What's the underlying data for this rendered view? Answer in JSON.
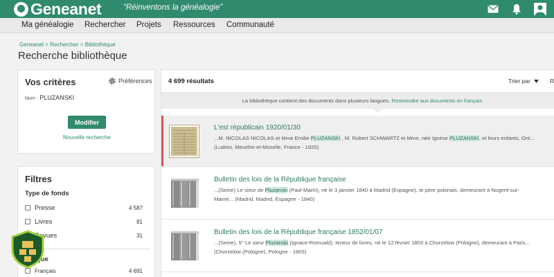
{
  "header": {
    "brand": "Geneanet",
    "slogan": "“Réinventons la généalogie”",
    "icons": [
      "mail-icon",
      "bell-icon",
      "user-icon"
    ]
  },
  "nav": [
    "Ma généalogie",
    "Rechercher",
    "Projets",
    "Ressources",
    "Communauté"
  ],
  "breadcrumb": "Geneanet > Rechercher > Bibliothèque",
  "page_title": "Recherche bibliothèque",
  "criteria": {
    "title": "Vos critères",
    "preferences_label": "Préférences",
    "name_label": "Nom :",
    "name_value": "PLUZANSKI",
    "modify_label": "Modifier",
    "new_search_label": "Nouvelle recherche"
  },
  "filters": {
    "title": "Filtres",
    "fonds_title": "Type de fonds",
    "fonds": [
      {
        "label": "Presse",
        "count": "4 587"
      },
      {
        "label": "Livres",
        "count": "81"
      },
      {
        "label": "Revues",
        "count": "31"
      }
    ],
    "lang_title": "Langue",
    "langs": [
      {
        "label": "Français",
        "count": "4 691"
      }
    ]
  },
  "results": {
    "count": "4 699 résultats",
    "sort_label": "Trier par",
    "sort_extra": "R",
    "notice": "La bibliothèque contient des documents dans plusieurs langues.",
    "notice_link": "Restreindre aux documents en français",
    "items": [
      {
        "title": "L'est républicain 1920/01/30",
        "line1_pre": "...M. NICOLAS NICOLAS et Mme Emilie ",
        "line1_hl1": "PLUZANSKI",
        "line1_mid": " , M. Robert SCHWARTZ et Mme, née Ignèse ",
        "line1_hl2": "PLUZANSKI",
        "line1_post": ", et leurs enfants, Ont...",
        "meta": "(Ludres, Meurthe-et-Moselle, France - 1920)"
      },
      {
        "title": "Bulletin des lois de la République française",
        "line1_pre": "...(Seine) Le sieur de ",
        "line1_hl1": "Pluzanski",
        "line1_post": " (Paul-Marin), né le 3 janvier 1840 à Madrid (Espagne), te père polonais, demeurant à Nogent-sur-",
        "line2": "Marne... (Madrid, Madrid, Espagne - 1840)"
      },
      {
        "title": "Bulletin des lois de la République française 1852/01/07",
        "line1_pre": "...(Seine), 5° Le sieur ",
        "line1_hl1": "Pluzanski",
        "line1_post": " (Ignace-Romuald), teneur de livres, né le 12 février 1803 à Chorzelow (Pologne), demeurant à Paris...",
        "line2": "(Chorzelow (Pologne), Pologne - 1803)"
      }
    ]
  }
}
